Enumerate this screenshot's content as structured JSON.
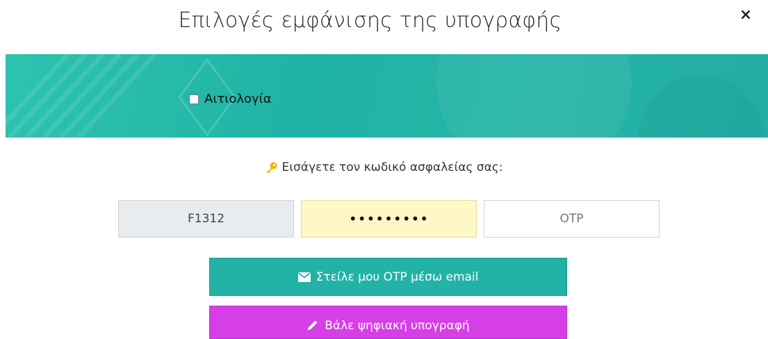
{
  "dialog": {
    "title": "Επιλογές εμφάνισης της υπογραφής",
    "close_glyph": "×"
  },
  "banner": {
    "reason_checkbox_checked": false,
    "reason_label": "Αιτιολογία",
    "background_color": "#22b3a6"
  },
  "security": {
    "prompt_icon": "key-icon",
    "prompt_text": "Εισάγετε τον κωδικό ασφαλείας σας:",
    "username_value": "F1312",
    "password_value": "•••••••••",
    "otp_value": "",
    "otp_placeholder": "OTP"
  },
  "actions": {
    "email_otp": {
      "label": "Στείλε μου OTP μέσω email",
      "icon": "envelope-icon",
      "color": "#22b3a6"
    },
    "digital_sign": {
      "label": "Βάλε ψηφιακή υπογραφή",
      "icon": "pencil-icon",
      "color": "#d63ee6"
    }
  }
}
